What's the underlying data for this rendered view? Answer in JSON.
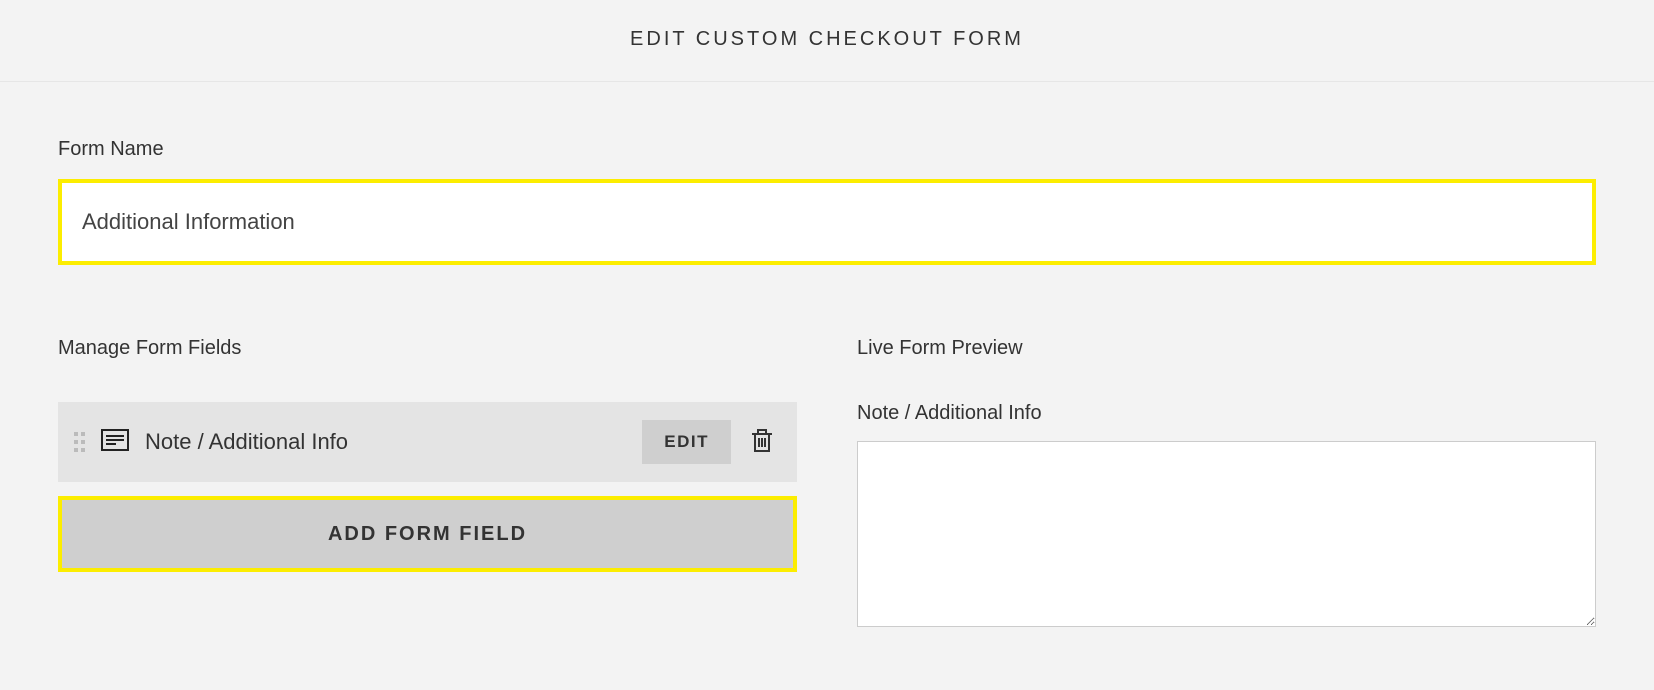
{
  "header": {
    "title": "EDIT CUSTOM CHECKOUT FORM"
  },
  "form_name": {
    "label": "Form Name",
    "value": "Additional Information"
  },
  "manage": {
    "heading": "Manage Form Fields",
    "fields": [
      {
        "label": "Note / Additional Info",
        "edit_label": "EDIT"
      }
    ],
    "add_button_label": "ADD FORM FIELD"
  },
  "preview": {
    "heading": "Live Form Preview",
    "field_label": "Note / Additional Info",
    "value": ""
  }
}
